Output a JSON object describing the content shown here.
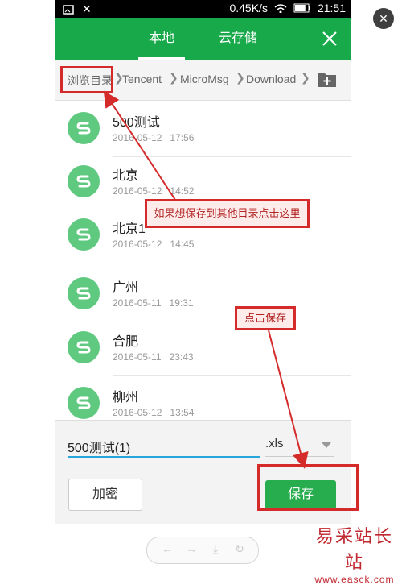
{
  "status": {
    "speed": "0.45K/s",
    "time": "21:51",
    "battery_level": 0.8
  },
  "header": {
    "tab_local": "本地",
    "tab_cloud": "云存储",
    "close_icon": "close-icon"
  },
  "breadcrumb": {
    "items": [
      "浏览目录",
      "Tencent",
      "MicroMsg",
      "Download"
    ]
  },
  "files": [
    {
      "name": "500测试",
      "date": "2016-05-12",
      "time": "17:56"
    },
    {
      "name": "北京",
      "date": "2016-05-12",
      "time": "14:52"
    },
    {
      "name": "北京1",
      "date": "2016-05-12",
      "time": "14:45"
    },
    {
      "name": "广州",
      "date": "2016-05-11",
      "time": "19:31"
    },
    {
      "name": "合肥",
      "date": "2016-05-11",
      "time": "23:43"
    },
    {
      "name": "柳州",
      "date": "2016-05-12",
      "time": "13:54"
    }
  ],
  "save": {
    "filename": "500测试(1)",
    "extension": ".xls",
    "encrypt_label": "加密",
    "save_label": "保存"
  },
  "annotations": {
    "other_dir_hint": "如果想保存到其他目录点击这里",
    "save_hint": "点击保存"
  },
  "watermark": {
    "title": "易采站长站",
    "url": "www.easck.com"
  },
  "colors": {
    "brand_green": "#17a94a",
    "annotation_red": "#d42a2a"
  }
}
